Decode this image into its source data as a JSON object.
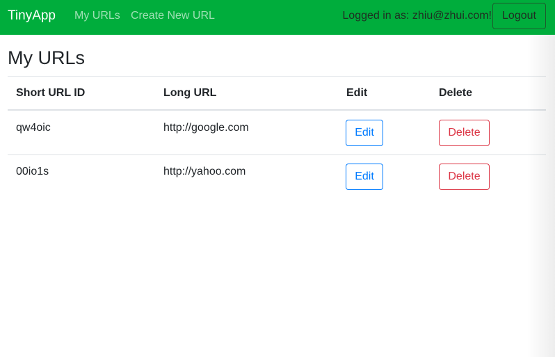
{
  "navbar": {
    "brand": "TinyApp",
    "links": [
      "My URLs",
      "Create New URL"
    ],
    "logged_in_text": "Logged in as: zhiu@zhui.com!",
    "logout_label": "Logout",
    "background_color": "#00ad3c"
  },
  "page": {
    "title": "My URLs"
  },
  "table": {
    "headers": [
      "Short URL ID",
      "Long URL",
      "Edit",
      "Delete"
    ],
    "rows": [
      {
        "short_id": "qw4oic",
        "long_url": "http://google.com",
        "edit_label": "Edit",
        "delete_label": "Delete"
      },
      {
        "short_id": "00io1s",
        "long_url": "http://yahoo.com",
        "edit_label": "Edit",
        "delete_label": "Delete"
      }
    ]
  },
  "colors": {
    "edit_button": "#007bff",
    "delete_button": "#dc3545"
  }
}
